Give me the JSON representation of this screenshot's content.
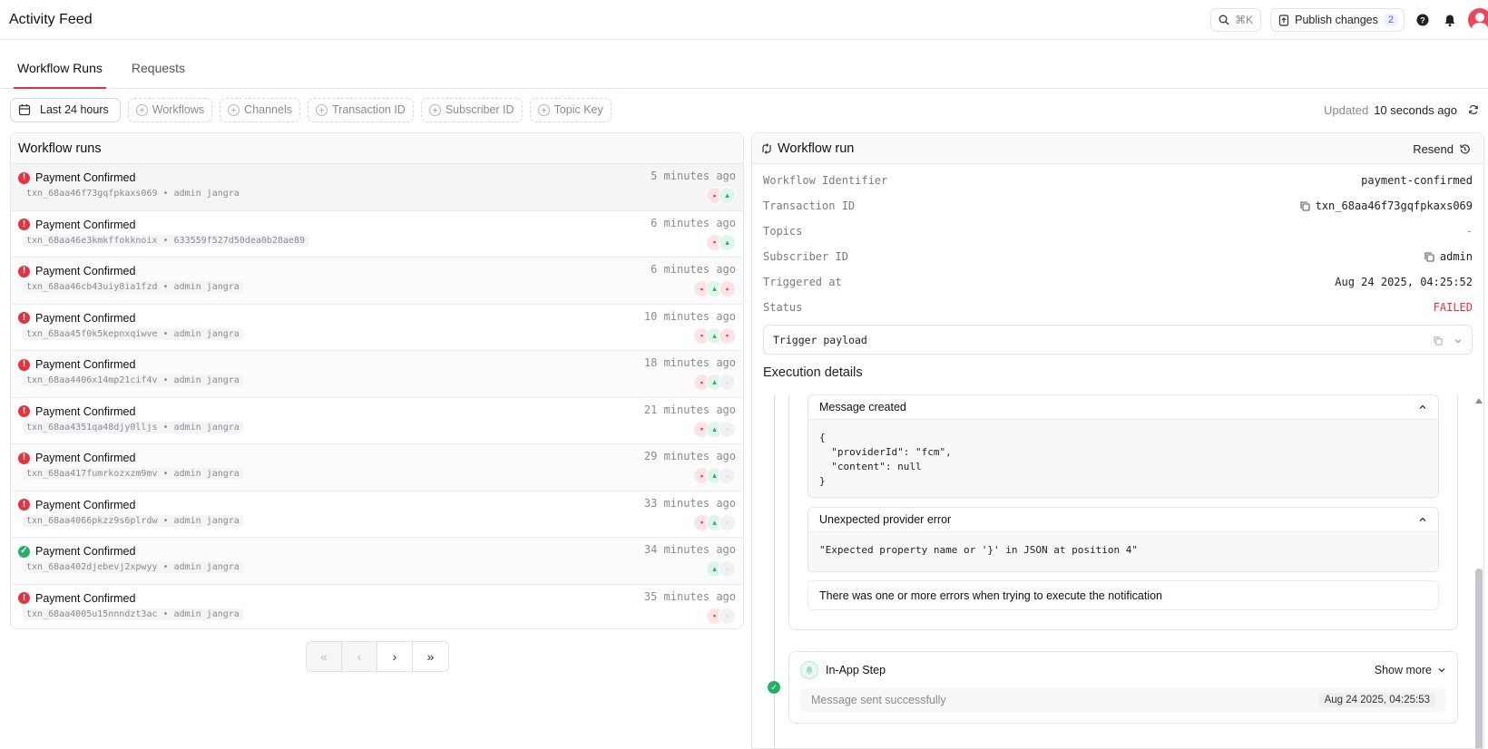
{
  "header": {
    "title": "Activity Feed",
    "search_shortcut": "⌘K",
    "publish_label": "Publish changes",
    "publish_count": "2"
  },
  "tabs": [
    {
      "label": "Workflow Runs"
    },
    {
      "label": "Requests"
    }
  ],
  "filters": {
    "date": "Last 24 hours",
    "workflows": "Workflows",
    "channels": "Channels",
    "transaction": "Transaction ID",
    "subscriber": "Subscriber ID",
    "topic": "Topic Key"
  },
  "updated": {
    "prefix": "Updated",
    "value": "10 seconds ago"
  },
  "runs_panel": {
    "title": "Workflow runs",
    "rows": [
      {
        "title": "Payment Confirmed",
        "sub": "txn_68aa46f73gqfpkaxs069 • admin jangra",
        "time": "5 minutes ago",
        "status": "error",
        "channels": [
          "r",
          "g"
        ]
      },
      {
        "title": "Payment Confirmed",
        "sub": "txn_68aa46e3kmkffokknoix • 633559f527d50dea0b28ae89",
        "time": "6 minutes ago",
        "status": "error",
        "channels": [
          "r",
          "g"
        ]
      },
      {
        "title": "Payment Confirmed",
        "sub": "txn_68aa46cb43uiy8ia1fzd • admin jangra",
        "time": "6 minutes ago",
        "status": "error",
        "channels": [
          "r",
          "g",
          "r"
        ]
      },
      {
        "title": "Payment Confirmed",
        "sub": "txn_68aa45f0k5kepnxqiwve • admin jangra",
        "time": "10 minutes ago",
        "status": "error",
        "channels": [
          "r",
          "g",
          "r"
        ]
      },
      {
        "title": "Payment Confirmed",
        "sub": "txn_68aa4406x14mp21cif4v • admin jangra",
        "time": "18 minutes ago",
        "status": "error",
        "channels": [
          "r",
          "g",
          "n"
        ]
      },
      {
        "title": "Payment Confirmed",
        "sub": "txn_68aa4351qa48djy0lljs • admin jangra",
        "time": "21 minutes ago",
        "status": "error",
        "channels": [
          "r",
          "g",
          "n"
        ]
      },
      {
        "title": "Payment Confirmed",
        "sub": "txn_68aa417fumrkozxzm9mv • admin jangra",
        "time": "29 minutes ago",
        "status": "error",
        "channels": [
          "r",
          "g",
          "n"
        ]
      },
      {
        "title": "Payment Confirmed",
        "sub": "txn_68aa4066pkzz9s6plrdw • admin jangra",
        "time": "33 minutes ago",
        "status": "error",
        "channels": [
          "r",
          "g",
          "n"
        ]
      },
      {
        "title": "Payment Confirmed",
        "sub": "txn_68aa402djebevj2xpwyy • admin jangra",
        "time": "34 minutes ago",
        "status": "ok",
        "channels": [
          "g",
          "n"
        ]
      },
      {
        "title": "Payment Confirmed",
        "sub": "txn_68aa4005u15nnndzt3ac • admin jangra",
        "time": "35 minutes ago",
        "status": "error",
        "channels": [
          "r",
          "n"
        ]
      }
    ]
  },
  "pager": {
    "first": "«",
    "prev": "‹",
    "next": "›",
    "last": "»"
  },
  "run_panel": {
    "title": "Workflow run",
    "resend": "Resend",
    "fields": {
      "workflow_identifier": {
        "label": "Workflow Identifier",
        "value": "payment-confirmed"
      },
      "transaction_id": {
        "label": "Transaction ID",
        "value": "txn_68aa46f73gqfpkaxs069"
      },
      "topics": {
        "label": "Topics",
        "value": "-"
      },
      "subscriber_id": {
        "label": "Subscriber ID",
        "value": "admin"
      },
      "triggered_at": {
        "label": "Triggered at",
        "value": "Aug 24 2025, 04:25:52"
      },
      "status": {
        "label": "Status",
        "value": "FAILED"
      }
    },
    "payload_label": "Trigger payload",
    "exec_title": "Execution details",
    "message_created": {
      "title": "Message created",
      "code": "{\n  \"providerId\": \"fcm\",\n  \"content\": null\n}"
    },
    "provider_error": {
      "title": "Unexpected provider error",
      "code": "\"Expected property name or '}' in JSON at position 4\""
    },
    "error_note": "There was one or more errors when trying to execute the notification",
    "in_app_step": {
      "title": "In-App Step",
      "show_more": "Show more",
      "message": "Message sent successfully",
      "timestamp": "Aug 24 2025, 04:25:53"
    }
  },
  "colors": {
    "accent": "#e0304a",
    "error": "#e5323f",
    "success": "#22b06b",
    "badge": "#5b5fd6"
  }
}
